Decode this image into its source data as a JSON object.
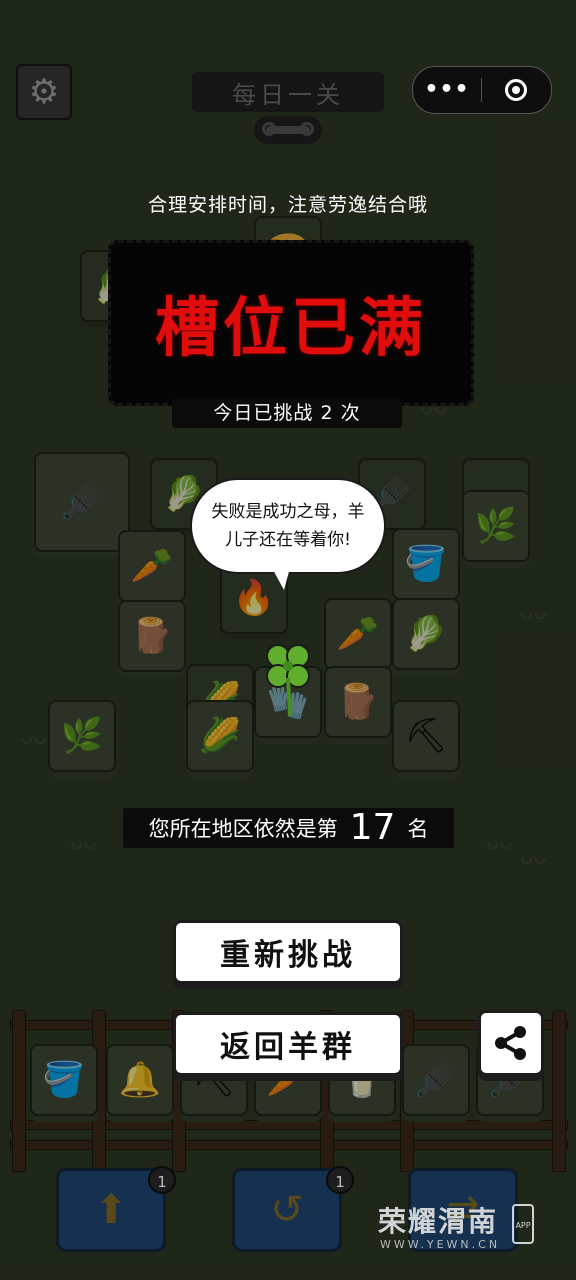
{
  "header": {
    "title": "每日一关",
    "settings_icon": "gear-icon",
    "capsule_more": "•••",
    "capsule_close_icon": "target-close-icon"
  },
  "tip": "合理安排时间，注意劳逸结合哦",
  "result": {
    "banner": "槽位已满",
    "attempts": "今日已挑战 2 次"
  },
  "speech_bubble": {
    "line1": "失败是成功之母，羊",
    "line2": "儿子还在等着你!"
  },
  "rank": {
    "prefix": "您所在地区依然是第",
    "number": "17",
    "suffix": "名"
  },
  "buttons": {
    "retry": "重新挑战",
    "return": "返回羊群",
    "share_icon": "share-icon"
  },
  "powerups": [
    {
      "icon": "move-out-icon",
      "count": "1"
    },
    {
      "icon": "undo-icon",
      "count": "1"
    },
    {
      "icon": "shuffle-icon",
      "count": ""
    }
  ],
  "watermark": {
    "name": "荣耀渭南",
    "url": "WWW.YEWN.CN",
    "app_label": "APP"
  },
  "colors": {
    "banner_text": "#e10d0d",
    "background": "#2c3524",
    "powerup_blue": "#163050"
  }
}
